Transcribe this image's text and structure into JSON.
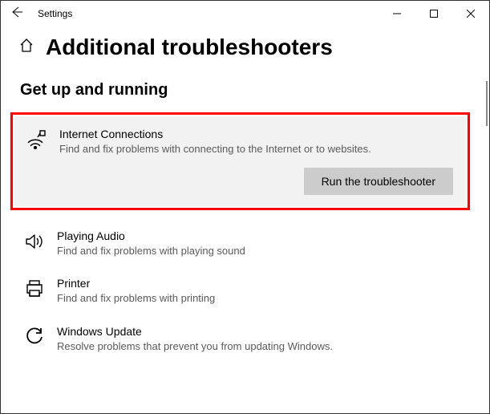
{
  "window": {
    "title": "Settings"
  },
  "page": {
    "title": "Additional troubleshooters"
  },
  "section": {
    "heading": "Get up and running"
  },
  "troubleshooters": {
    "internet": {
      "title": "Internet Connections",
      "desc": "Find and fix problems with connecting to the Internet or to websites.",
      "action": "Run the troubleshooter"
    },
    "audio": {
      "title": "Playing Audio",
      "desc": "Find and fix problems with playing sound"
    },
    "printer": {
      "title": "Printer",
      "desc": "Find and fix problems with printing"
    },
    "update": {
      "title": "Windows Update",
      "desc": "Resolve problems that prevent you from updating Windows."
    }
  }
}
